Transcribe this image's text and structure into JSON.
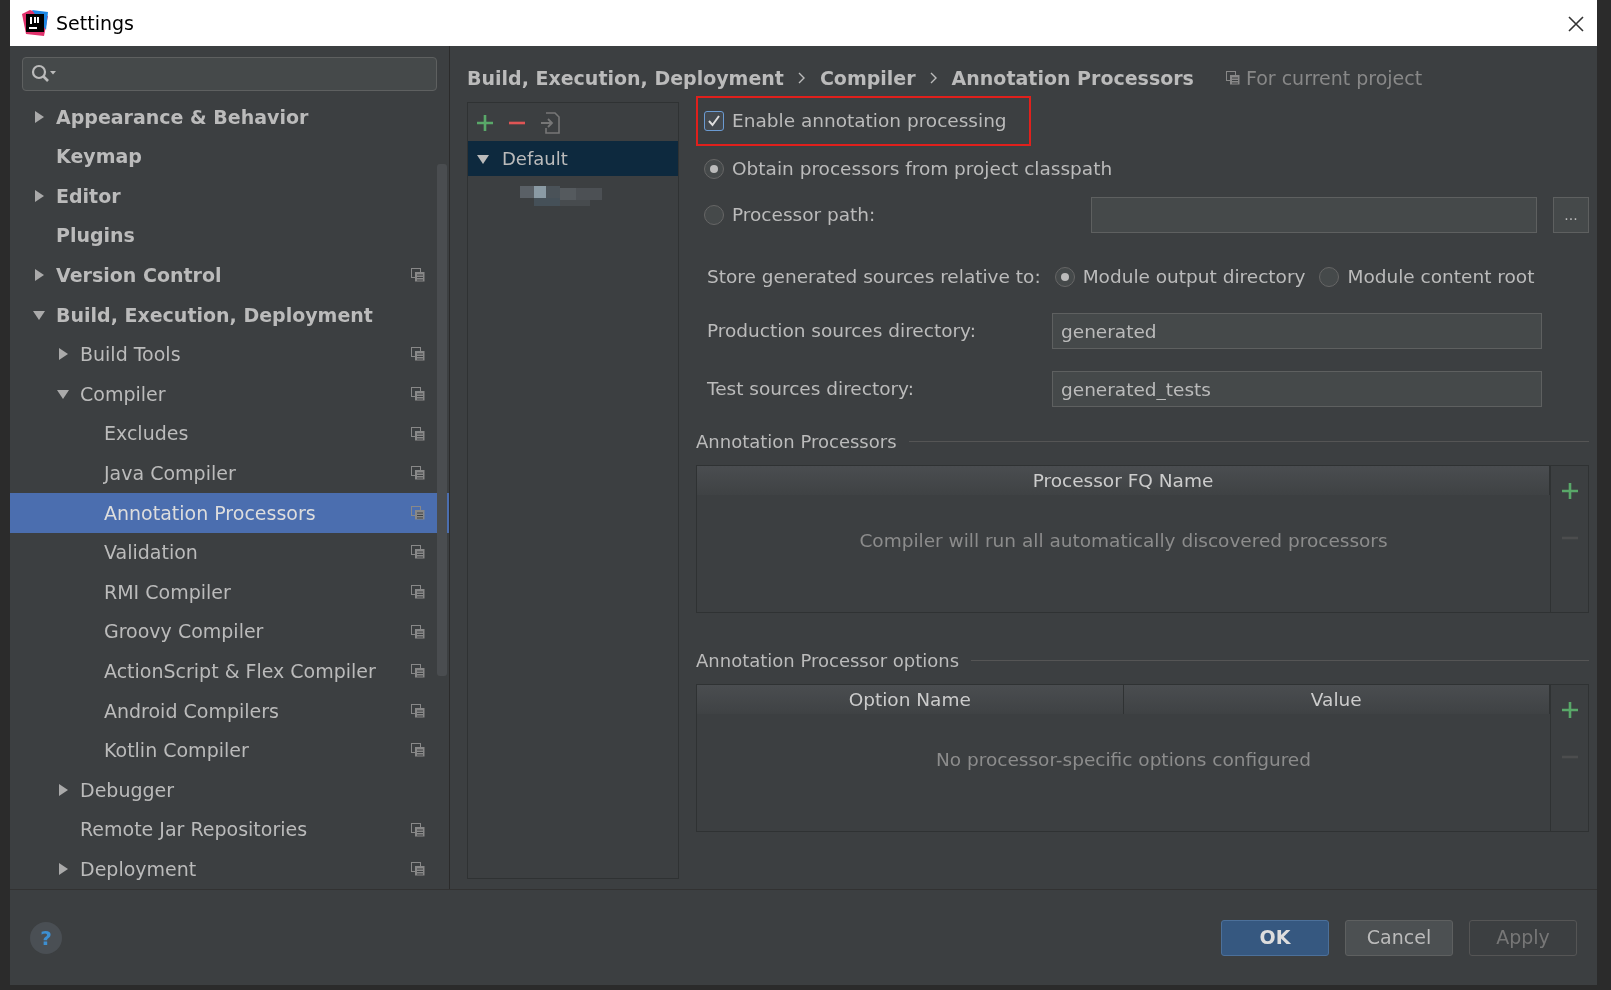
{
  "window": {
    "title": "Settings"
  },
  "sidebar": {
    "items": [
      {
        "label": "Appearance & Behavior",
        "expanded": false
      },
      {
        "label": "Keymap"
      },
      {
        "label": "Editor",
        "expanded": false
      },
      {
        "label": "Plugins"
      },
      {
        "label": "Version Control",
        "expanded": false,
        "project_level": true
      },
      {
        "label": "Build, Execution, Deployment",
        "expanded": true,
        "children": [
          {
            "label": "Build Tools",
            "expanded": false,
            "project_level": true
          },
          {
            "label": "Compiler",
            "expanded": true,
            "project_level": true,
            "children": [
              {
                "label": "Excludes",
                "project_level": true,
                "selected": false
              },
              {
                "label": "Java Compiler",
                "project_level": true,
                "selected": false
              },
              {
                "label": "Annotation Processors",
                "project_level": true,
                "selected": true
              },
              {
                "label": "Validation",
                "project_level": true,
                "selected": false
              },
              {
                "label": "RMI Compiler",
                "project_level": true,
                "selected": false
              },
              {
                "label": "Groovy Compiler",
                "project_level": true,
                "selected": false
              },
              {
                "label": "ActionScript & Flex Compiler",
                "project_level": true,
                "selected": false
              },
              {
                "label": "Android Compilers",
                "project_level": true,
                "selected": false
              },
              {
                "label": "Kotlin Compiler",
                "project_level": true,
                "selected": false
              }
            ]
          },
          {
            "label": "Debugger",
            "expanded": false
          },
          {
            "label": "Remote Jar Repositories",
            "project_level": true
          },
          {
            "label": "Deployment",
            "expanded": false,
            "project_level": true
          }
        ]
      }
    ]
  },
  "breadcrumb": [
    "Build, Execution, Deployment",
    "Compiler",
    "Annotation Processors"
  ],
  "scope": "For current project",
  "profiles": [
    {
      "label": "Default",
      "expanded": true,
      "selected": true
    }
  ],
  "enable": {
    "label": "Enable annotation processing",
    "checked": true,
    "highlighted": true
  },
  "source": [
    {
      "label": "Obtain processors from project classpath",
      "selected": true
    },
    {
      "label": "Processor path:",
      "selected": false
    }
  ],
  "browse_button": "...",
  "store": {
    "label": "Store generated sources relative to:",
    "options": [
      {
        "label": "Module output directory",
        "selected": true
      },
      {
        "label": "Module content root",
        "selected": false
      }
    ]
  },
  "fields": [
    {
      "label": "Production sources directory:",
      "value": "generated"
    },
    {
      "label": "Test sources directory:",
      "value": "generated_tests"
    }
  ],
  "tables": [
    {
      "title": "Annotation Processors",
      "columns": [
        "Processor FQ Name"
      ],
      "empty_text": "Compiler will run all automatically discovered processors"
    },
    {
      "title": "Annotation Processor options",
      "columns": [
        "Option Name",
        "Value"
      ],
      "empty_text": "No processor-specific options configured"
    }
  ],
  "help": "?",
  "buttons": [
    {
      "label": "OK",
      "kind": "primary",
      "disabled": false
    },
    {
      "label": "Cancel",
      "kind": "default",
      "disabled": false
    },
    {
      "label": "Apply",
      "kind": "default",
      "disabled": true
    }
  ]
}
